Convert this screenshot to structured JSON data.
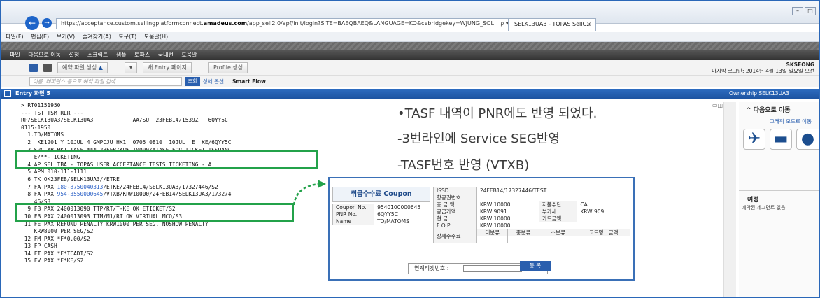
{
  "browser": {
    "url_prefix": "https://acceptance.custom.sellingplatformconnect.",
    "url_domain": "amadeus.com",
    "url_suffix": "/app_sell2.0/apf/init/login?SITE=BAEQBAEQ&LANGUAGE=KO&cebridgekey=WJUNG_SOL",
    "url_controls": "ρ ▾ C",
    "tab_title": "SELK13UA3 - TOPAS SellC...",
    "tab_close": "×",
    "menu": [
      "파일(F)",
      "편집(E)",
      "보기(V)",
      "즐겨찾기(A)",
      "도구(T)",
      "도움말(H)"
    ]
  },
  "app": {
    "menu": [
      "파일",
      "다음으로 이동",
      "설정",
      "스크립트",
      "샘플",
      "토파스",
      "국내선",
      "도움말"
    ],
    "toolbar": {
      "reservation_button": "예약 파일 생성",
      "new_entry_button": "새 Entry 페이지",
      "profile_button": "Profile 생성"
    },
    "user": {
      "name": "SKSEONG",
      "last_login": "마지막 로그인: 2014년 4월 13일 일요일 오전"
    },
    "search": {
      "placeholder": "이름, 레퍼런스 등으로 예약 파일 검색",
      "button": "조회",
      "detail_option": "상세 옵션",
      "smart_flow": "Smart Flow"
    },
    "entry_bar": {
      "title": "Entry 화면 5",
      "ownership": "Ownership SELK13UA3"
    }
  },
  "terminal": {
    "lines": [
      "> RT01151950",
      "",
      "--- TST TSM RLR ---",
      "RP/SELK13UA3/SELK13UA3            AA/SU  23FEB14/1539Z   6QYY5C",
      "0115-1950",
      "  1.TO/MATOMS",
      "  2  KE1201 Y 10JUL 4 GMPCJU HK1  0705 0810  10JUL  E  KE/6QYY5C",
      "  3 SVC XB HK1 TASF-*** 23FEB/KRW 10000/*TASF FOR TICKET ISSUANC",
      "    E/**-TICKETING",
      "  4 AP SEL TBA - TOPAS USER ACCEPTANCE TESTS TICKETING - A",
      "  5 APM 010-111-1111",
      "  6 TK OK23FEB/SELK13UA3//ETRE",
      "  7 FA PAX ",
      "  8 FA PAX ",
      "    46/S3",
      "  9 FB PAX 2400013090 TTP/RT/T-KE OK ETICKET/S2",
      " 10 FB PAX 2400013093 TTM/M1/RT OK VIRTUAL MCO/S3",
      " 11 FE PAX REFUND PENALTY KRW1000 PER SEG. NOSHOW PENALTY",
      "    KRW8000 PER SEG/S2",
      " 12 FM PAX *F*0.00/S2",
      " 13 FP CASH",
      " 14 FT PAX *F*TCADT/S2",
      " 15 FV PAX *F*KE/S2"
    ],
    "line7_ticket": "180-8750040313",
    "line7_rest": "/ETKE/24FEB14/SELK13UA3/17327446/S2",
    "line8_ticket": "954-3550000645",
    "line8_rest": "/VTXB/KRW10000/24FEB14/SELK13UA3/173274"
  },
  "annotations": [
    "•TASF 내역이 PNR에도 반영 되었다.",
    "-3번라인에 Service SEG반영",
    "-TASF번호 반영 (VTXB)"
  ],
  "coupon": {
    "title": "취급수수료 Coupon",
    "left_rows": [
      {
        "label": "Coupon No.",
        "value": "9540100000645"
      },
      {
        "label": "PNR No.",
        "value": "6QYY5C"
      },
      {
        "label": "Name",
        "value": "TO/MATOMS"
      }
    ],
    "issd_label": "ISSD",
    "issd_value": "24FEB14/17327446/TEST",
    "airline_label": "항공권번호",
    "rows": [
      {
        "label": "총 금 액",
        "value": "KRW 10000",
        "label2": "지불수단",
        "value2": "CA"
      },
      {
        "label": "공급가액",
        "value": "KRW 9091",
        "label2": "부가세",
        "value2": "KRW 909"
      },
      {
        "label": "현   금",
        "value": "KRW 10000",
        "label2": "카드금액",
        "value2": ""
      },
      {
        "label": "F O P",
        "value": "KRW 10000",
        "label2": "",
        "value2": ""
      }
    ],
    "detail_label": "상세수수료",
    "detail_headers": [
      "대분류",
      "중분류",
      "소분류",
      "코드명",
      "금액"
    ],
    "link_label": "연계티켓번호 :",
    "register_button": "등 록"
  },
  "right_pane": {
    "title": "다음으로 이동",
    "graphic_mode": "그래픽 모드로 이동",
    "trip_title": "여정",
    "trip_empty": "예약된 세그먼트 없음"
  },
  "colors": {
    "frame": "#2a67b8",
    "highlight_box": "#23a24a",
    "entry_bar": "#1d54a1",
    "ticket_link": "#2d62c7"
  }
}
